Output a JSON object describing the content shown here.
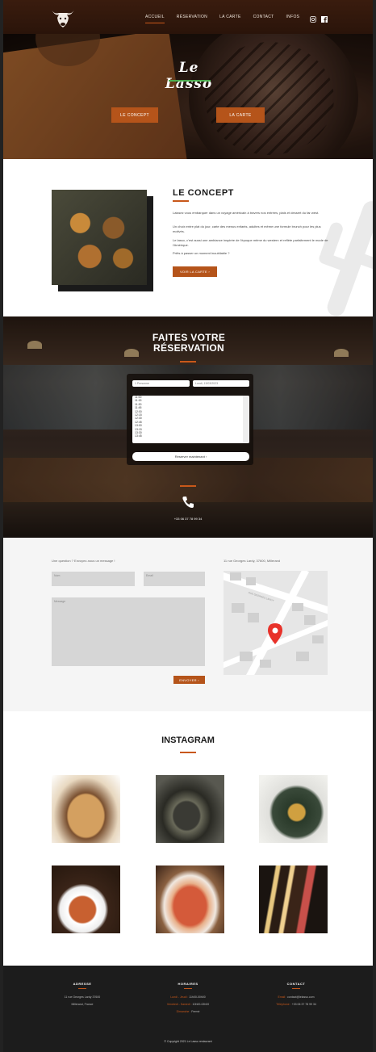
{
  "nav": {
    "items": [
      {
        "label": "ACCUEIL",
        "active": true
      },
      {
        "label": "RÉSERVATION",
        "active": false
      },
      {
        "label": "LA CARTE",
        "active": false
      },
      {
        "label": "CONTACT",
        "active": false
      },
      {
        "label": "INFOS",
        "active": false
      }
    ],
    "icons": [
      "instagram-icon",
      "facebook-icon"
    ]
  },
  "hero": {
    "brand": "Le Lasso",
    "buttons": [
      "LE CONCEPT",
      "LA CARTE"
    ]
  },
  "concept": {
    "title": "LE CONCEPT",
    "p1": "Laissez vous embarquer dans un voyage américain à travers nos entrées, plats et dessert du far west.",
    "p2": "Un choix entre plat du jour, carte des menus enfants, adultes et même une formule brunch pour les plus motivés.",
    "p3": "Le lasso, c'est aussi une ambiance inspirée de l'époque même du western et reflète parfaitement le mode de l'Amérique.",
    "p4": "Prêts à passer un moment inoubliable ?",
    "button": "VOIR LA CARTE"
  },
  "reservation": {
    "title": "FAITES VOTRE RÉSERVATION",
    "people_placeholder": "1 Personne",
    "date_placeholder": "Lundi, 13/03/2023",
    "times": [
      "11:00",
      "11:15",
      "11:30",
      "11:45",
      "12:00",
      "12:15",
      "12:30",
      "12:45",
      "13:00",
      "13:15",
      "13:30",
      "13:45"
    ],
    "button": "Réserver maintenant",
    "phone": "+33 06 37 78 99 34"
  },
  "contact": {
    "intro": "Une question ? Envoyez-nous un message !",
    "name_placeholder": "Nom",
    "email_placeholder": "Email",
    "message_placeholder": "Message",
    "send": "ENVOYER",
    "address": "11 rue Georges Lardy, 37600, Millerand",
    "map_street": "RUE GEORGES LARDY"
  },
  "instagram": {
    "title": "INSTAGRAM"
  },
  "footer": {
    "address_title": "ADRESSE",
    "address_lines": [
      "11 rue Georges Lardy 37600",
      "Millerand, France"
    ],
    "hours_title": "HORAIRES",
    "hours": [
      {
        "k": "Lundi - Jeudi :",
        "v": "11h00-00h00"
      },
      {
        "k": "Vendredi - Samedi :",
        "v": "10h00-02h00"
      },
      {
        "k": "Dimanche :",
        "v": "Fermé"
      }
    ],
    "contact_title": "CONTACT",
    "contact_lines": [
      {
        "k": "Email :",
        "v": "contact@lelasso.com"
      },
      {
        "k": "Téléphone :",
        "v": "+33 06 37 78 99 34"
      }
    ],
    "copyright": "© Copyright 2021 Le Lasso restaurant"
  },
  "colors": {
    "accent": "#c8581a",
    "nav": "#2a140a",
    "footer": "#1c1c1c"
  }
}
